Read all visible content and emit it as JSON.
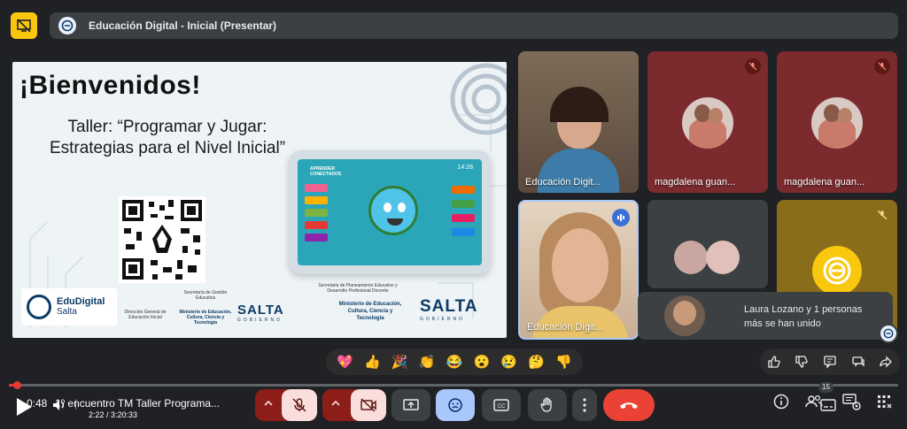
{
  "meeting": {
    "title": "Educación Digital - Inicial (Presentar)"
  },
  "slide": {
    "heading": "¡Bienvenidos!",
    "subtitle": "Taller: “Programar y Jugar: Estrategias para el Nivel Inicial”",
    "brand_name": "EduDigital",
    "brand_sub": "Salta",
    "footer_left": "Dirección General de Educación Inicial",
    "footer_mid": "Secretaría de Gestión Educativa",
    "ministry": "Ministerio de Educación, Cultura, Ciencia y Tecnología",
    "salta": "SALTA",
    "gobierno": "GOBIERNO",
    "footer_right_top": "Secretaría de Planeamiento Educativo y Desarrollo Profesional Docente",
    "tablet_label": "APRENDER CONECTADOS",
    "tablet_time": "14:28"
  },
  "participants": [
    {
      "name": "Educación Digit...",
      "muted": false,
      "type": "video"
    },
    {
      "name": "magdalena guan...",
      "muted": true,
      "type": "avatar"
    },
    {
      "name": "magdalena guan...",
      "muted": true,
      "type": "avatar"
    },
    {
      "name": "Educación Digit...",
      "muted": false,
      "speaking": true,
      "type": "video"
    },
    {
      "name": "",
      "type": "group"
    },
    {
      "name": "",
      "muted": true,
      "type": "logo"
    }
  ],
  "notification": {
    "text_line1": "Laura Lozano y 1 personas",
    "text_line2": "más se han unido"
  },
  "reactions": [
    "💖",
    "👍",
    "🎉",
    "👏",
    "😂",
    "😮",
    "😢",
    "🤔",
    "👎"
  ],
  "player": {
    "progress": 0.009,
    "time_prefix": "0:48",
    "episode_title": "1º encuentro TM Taller Programa...",
    "time": "2:22 / 3:20:33",
    "people_count": "15"
  },
  "colors": {
    "accent_yellow": "#f9c80e",
    "end_call": "#ea4335",
    "mute_red": "#8c1d18",
    "tile_maroon": "#7b2a2e",
    "active_blue": "#a8c7fa"
  }
}
